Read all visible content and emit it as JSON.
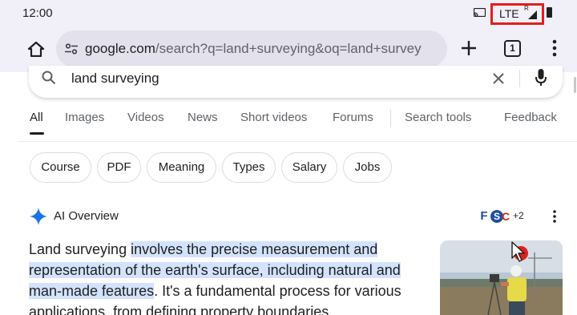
{
  "status_bar": {
    "time": "12:00",
    "network": "LTE",
    "roaming": "R",
    "icons": [
      "cast-icon",
      "signal-icon",
      "battery-icon"
    ],
    "highlight_color": "#e0201b"
  },
  "toolbar": {
    "url_host": "google.com",
    "url_rest": "/search?q=land+surveying&oq=land+survey",
    "tab_count": "1",
    "icons": [
      "home-icon",
      "tune-icon",
      "plus-icon",
      "tabs-icon",
      "menu-icon"
    ]
  },
  "search": {
    "query": "land surveying",
    "icons": [
      "search-icon",
      "clear-icon",
      "mic-icon"
    ]
  },
  "tabs": {
    "items": [
      "All",
      "Images",
      "Videos",
      "News",
      "Short videos",
      "Forums",
      "Search tools",
      "Feedback"
    ],
    "active": "All"
  },
  "chips": [
    "Course",
    "PDF",
    "Meaning",
    "Types",
    "Salary",
    "Jobs"
  ],
  "ai_overview": {
    "title": "AI Overview",
    "source_more": "+2",
    "favicon_letters": [
      "F",
      "S",
      "C"
    ],
    "text_plain_1": "Land surveying ",
    "text_highlight": "involves the precise measurement and representation of the earth's surface, including natural and man-made features",
    "text_plain_2": ". It's a fundamental process for various applications, from defining property boundaries",
    "highlight_color": "#d3e3fd",
    "accent_color": "#1a73e8"
  }
}
